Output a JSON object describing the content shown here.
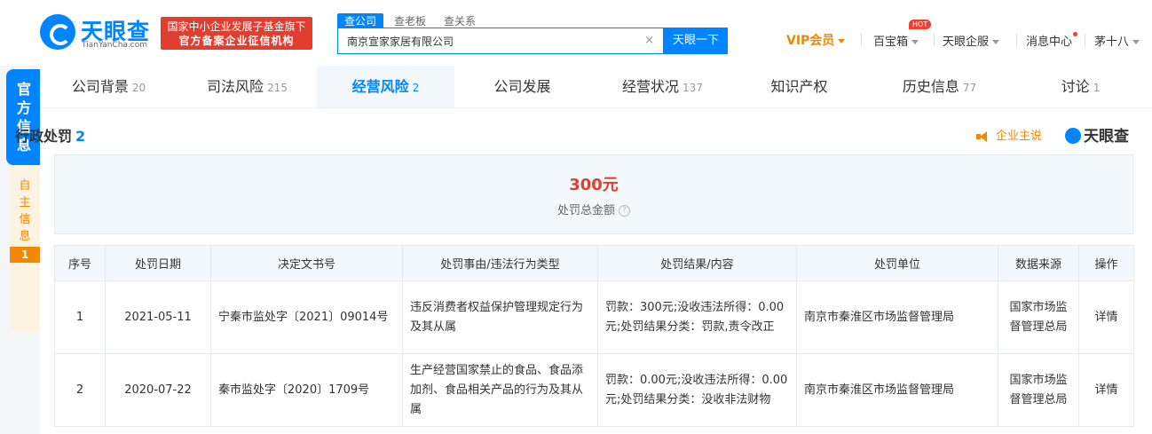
{
  "header": {
    "logo_text": "天眼查",
    "logo_sub": "TianYanCha.com",
    "badge_line1": "国家中小企业发展子基金旗下",
    "badge_line2": "官方备案企业征信机构",
    "search_tabs": [
      "查公司",
      "查老板",
      "查关系"
    ],
    "search_value": "南京宣家家居有限公司",
    "search_clear": "×",
    "search_button": "天眼一下",
    "vip": "VIP会员",
    "hot": "HOT",
    "baibaoxiang": "百宝箱",
    "qifu": "天眼企服",
    "messages": "消息中心",
    "user": "茅十八"
  },
  "sidebar": {
    "official": "官方信息",
    "self": "自主信息",
    "self_count": "1"
  },
  "tabs": [
    {
      "label": "公司背景",
      "count": "20"
    },
    {
      "label": "司法风险",
      "count": "215"
    },
    {
      "label": "经营风险",
      "count": "2"
    },
    {
      "label": "公司发展",
      "count": ""
    },
    {
      "label": "经营状况",
      "count": "137"
    },
    {
      "label": "知识产权",
      "count": ""
    },
    {
      "label": "历史信息",
      "count": "77"
    },
    {
      "label": "讨论",
      "count": "1"
    }
  ],
  "section": {
    "title": "行政处罚",
    "count": "2",
    "company_says": "企业主说",
    "brand": "天眼查"
  },
  "summary": {
    "amount": "300元",
    "label": "处罚总金额",
    "help": "?"
  },
  "table": {
    "headers": [
      "序号",
      "处罚日期",
      "决定文书号",
      "处罚事由/违法行为类型",
      "处罚结果/内容",
      "处罚单位",
      "数据来源",
      "操作"
    ],
    "rows": [
      {
        "no": "1",
        "date": "2021-05-11",
        "doc": "宁秦市监处字〔2021〕09014号",
        "reason": "违反消费者权益保护管理规定行为及其从属",
        "result": "罚款：300元;没收违法所得：0.00元;处罚结果分类：罚款,责令改正",
        "unit": "南京市秦淮区市场监督管理局",
        "source": "国家市场监督管理总局",
        "action": "详情"
      },
      {
        "no": "2",
        "date": "2020-07-22",
        "doc": "秦市监处字〔2020〕1709号",
        "reason": "生产经营国家禁止的食品、食品添加剂、食品相关产品的行为及其从属",
        "result": "罚款：0.00元;没收违法所得：0.00元;处罚结果分类：没收非法财物",
        "unit": "南京市秦淮区市场监督管理局",
        "source": "国家市场监督管理总局",
        "action": "详情"
      }
    ]
  },
  "colors": {
    "brand_blue": "#0084ff",
    "alert_red": "#e33d2f",
    "vip_orange": "#f08800"
  }
}
